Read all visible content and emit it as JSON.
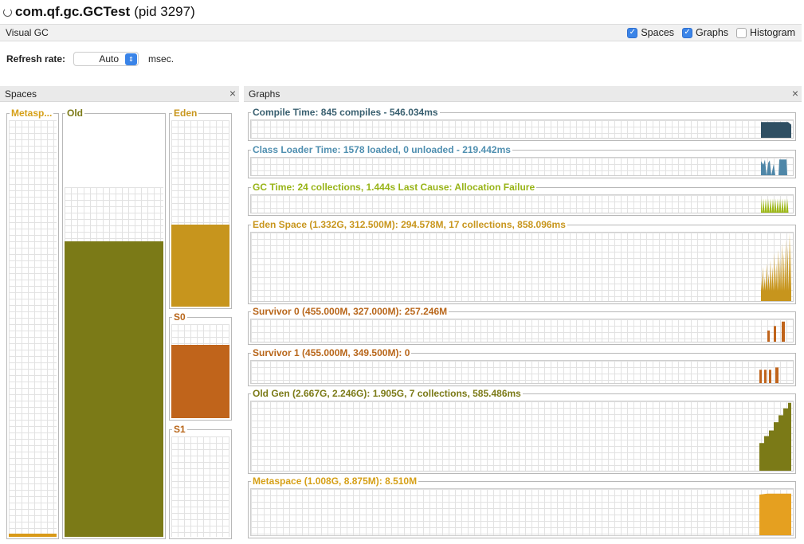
{
  "window": {
    "app_name": "com.qf.gc.GCTest",
    "pid_text": "(pid 3297)"
  },
  "tab": {
    "label": "Visual GC"
  },
  "options": [
    {
      "label": "Spaces",
      "checked": true
    },
    {
      "label": "Graphs",
      "checked": true
    },
    {
      "label": "Histogram",
      "checked": false
    }
  ],
  "refresh": {
    "label": "Refresh rate:",
    "value": "Auto",
    "unit": "msec."
  },
  "spaces_panel": {
    "title": "Spaces",
    "close": "×"
  },
  "graphs_panel": {
    "title": "Graphs",
    "close": "×"
  },
  "colors": {
    "metaspace": "#d99a18",
    "old": "#7b7a17",
    "eden": "#c7951d",
    "s0": "#c0641b",
    "s1": "#c0641b",
    "compile": "#2f4f63",
    "classloader": "#4f87a8",
    "gc": "#9db818",
    "metaspace_graph": "#e5a020",
    "title_metaspace": "#d6a018",
    "title_old": "#7b7a17",
    "title_eden": "#c8961d",
    "title_survivor": "#b8661a",
    "title_compile": "#3a6070",
    "title_classloader": "#4f8fb0",
    "title_gc": "#98b418"
  },
  "spaces": [
    {
      "name": "Metasp...",
      "key": "metaspace",
      "fill_fraction": 0.007,
      "reserved_fraction": 1.0
    },
    {
      "name": "Old",
      "key": "old",
      "fill_fraction": 0.71,
      "reserved_fraction": 0.84
    },
    {
      "name": "Eden",
      "key": "eden",
      "fill_fraction": 0.44,
      "reserved_fraction": 1.0
    },
    {
      "name": "S0",
      "key": "s0",
      "fill_fraction": 0.78,
      "reserved_fraction": 1.0
    },
    {
      "name": "S1",
      "key": "s1",
      "fill_fraction": 0.0,
      "reserved_fraction": 1.0
    }
  ],
  "graphs": [
    {
      "key": "compile",
      "title": "Compile Time: 845 compiles - 546.034ms",
      "title_color": "title_compile",
      "color": "compile"
    },
    {
      "key": "classloader",
      "title": "Class Loader Time: 1578 loaded, 0 unloaded - 219.442ms",
      "title_color": "title_classloader",
      "color": "classloader"
    },
    {
      "key": "gc",
      "title": "GC Time: 24 collections, 1.444s  Last Cause: Allocation Failure",
      "title_color": "title_gc",
      "color": "gc"
    },
    {
      "key": "eden",
      "title": "Eden Space (1.332G, 312.500M): 294.578M, 17 collections, 858.096ms",
      "title_color": "title_eden",
      "color": "eden"
    },
    {
      "key": "s0",
      "title": "Survivor 0 (455.000M, 327.000M): 257.246M",
      "title_color": "title_survivor",
      "color": "s0"
    },
    {
      "key": "s1",
      "title": "Survivor 1 (455.000M, 349.500M): 0",
      "title_color": "title_survivor",
      "color": "s1"
    },
    {
      "key": "old",
      "title": "Old Gen (2.667G, 2.246G): 1.905G, 7 collections, 585.486ms",
      "title_color": "title_old",
      "color": "old"
    },
    {
      "key": "metaspace",
      "title": "Metaspace (1.008G, 8.875M): 8.510M",
      "title_color": "title_metaspace",
      "color": "metaspace_graph"
    }
  ]
}
